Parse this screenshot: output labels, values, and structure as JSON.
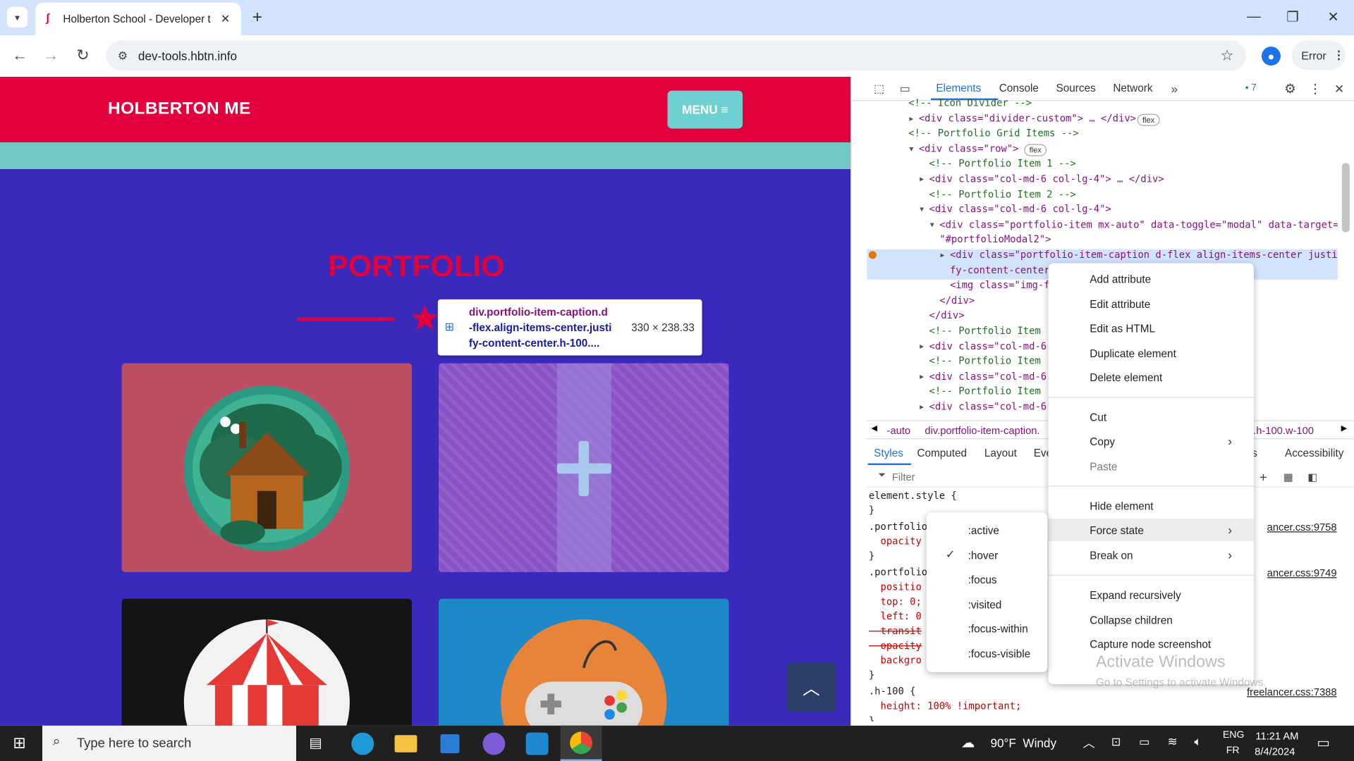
{
  "browser": {
    "tab_title": "Holberton School - Developer t",
    "url": "dev-tools.hbtn.info",
    "profile_label": "Error"
  },
  "page": {
    "brand": "HOLBERTON ME",
    "menu_label": "MENU ≡",
    "portfolio_title": "PORTFOLIO",
    "tooltip": {
      "selector_line1": "div.portfolio-item-caption.d",
      "selector_line2": "-flex.align-items-center.justi",
      "selector_line3": "fy-content-center.h-100....",
      "size": "330 × 238.33"
    }
  },
  "devtools": {
    "tabs": [
      "Elements",
      "Console",
      "Sources",
      "Network"
    ],
    "issues_count": "7",
    "tree": [
      {
        "indent": 0,
        "html": "<!-- Icon Divider -->"
      },
      {
        "indent": 1,
        "html": "<div class=\"divider-custom\"> … </div>",
        "badge": "flex"
      },
      {
        "indent": 0,
        "html": "<!-- Portfolio Grid Items -->"
      },
      {
        "indent": 1,
        "html": "<div class=\"row\">",
        "badge": "flex"
      },
      {
        "indent": 2,
        "html": "<!-- Portfolio Item 1 -->"
      },
      {
        "indent": 2,
        "html": "<div class=\"col-md-6 col-lg-4\"> … </div>"
      },
      {
        "indent": 2,
        "html": "<!-- Portfolio Item 2 -->"
      },
      {
        "indent": 2,
        "html": "<div class=\"col-md-6 col-lg-4\">"
      },
      {
        "indent": 3,
        "html": "<div class=\"portfolio-item mx-auto\" data-toggle=\"modal\" data-target="
      },
      {
        "indent": 3,
        "html": "\"#portfolioModal2\">"
      },
      {
        "indent": 4,
        "html": "<div class=\"portfolio-item-caption d-flex align-items-center justi"
      },
      {
        "indent": 4,
        "html": "fy-content-center"
      },
      {
        "indent": 4,
        "html": "<img class=\"img-f                                         alt=\"cake\">"
      },
      {
        "indent": 3,
        "html": "</div>"
      },
      {
        "indent": 2,
        "html": "</div>"
      },
      {
        "indent": 2,
        "html": "<!-- Portfolio Item"
      },
      {
        "indent": 2,
        "html": "<div class=\"col-md-6"
      },
      {
        "indent": 2,
        "html": "<!-- Portfolio Item"
      },
      {
        "indent": 2,
        "html": "<div class=\"col-md-6"
      },
      {
        "indent": 2,
        "html": "<!-- Portfolio Item"
      },
      {
        "indent": 2,
        "html": "<div class=\"col-md-6"
      }
    ],
    "breadcrumb": [
      "-auto",
      "div.portfolio-item-caption.",
      "ter.h-100.w-100"
    ],
    "styles_tabs": [
      "Styles",
      "Computed",
      "Layout",
      "Eve",
      "ies",
      "Accessibility"
    ],
    "filter_placeholder": "Filter",
    "styles": [
      {
        "line": "element.style {"
      },
      {
        "line": "}"
      },
      {
        "line": ".portfolio",
        "source": "ancer.css:9758"
      },
      {
        "line": "  opacity"
      },
      {
        "line": "}"
      },
      {
        "line": ".portfolio",
        "source": "ancer.css:9749"
      },
      {
        "line": "  positio"
      },
      {
        "line": "  top: 0;"
      },
      {
        "line": "  left: 0"
      },
      {
        "line": "  transit"
      },
      {
        "line": "  opacity"
      },
      {
        "line": "  backgro"
      },
      {
        "line": "}"
      },
      {
        "line": ".h-100 {",
        "source": "freelancer.css:7388"
      },
      {
        "line": "  height: 100% !important;"
      },
      {
        "line": "}"
      }
    ],
    "context_menu": {
      "group1": [
        "Add attribute",
        "Edit attribute",
        "Edit as HTML",
        "Duplicate element",
        "Delete element"
      ],
      "group2": [
        "Cut",
        "Copy",
        "Paste"
      ],
      "group3": [
        "Hide element",
        "Force state",
        "Break on"
      ],
      "group4": [
        "Expand recursively",
        "Collapse children",
        "Capture node screenshot"
      ]
    },
    "force_state_submenu": [
      ":active",
      ":hover",
      ":focus",
      ":visited",
      ":focus-within",
      ":focus-visible"
    ],
    "checked_state": ":hover",
    "watermark_title": "Activate Windows",
    "watermark_sub": "Go to Settings to activate Windows."
  },
  "taskbar": {
    "search_placeholder": "Type here to search",
    "weather": "90°F  Windy",
    "lang_top": "ENG",
    "lang_bottom": "FR",
    "time": "11:21 AM",
    "date": "8/4/2024"
  },
  "colors": {
    "navbar": "#e2003d",
    "page_bg": "#3a2abc",
    "teal": "#72c8c6",
    "accent": "#1a73e8"
  }
}
